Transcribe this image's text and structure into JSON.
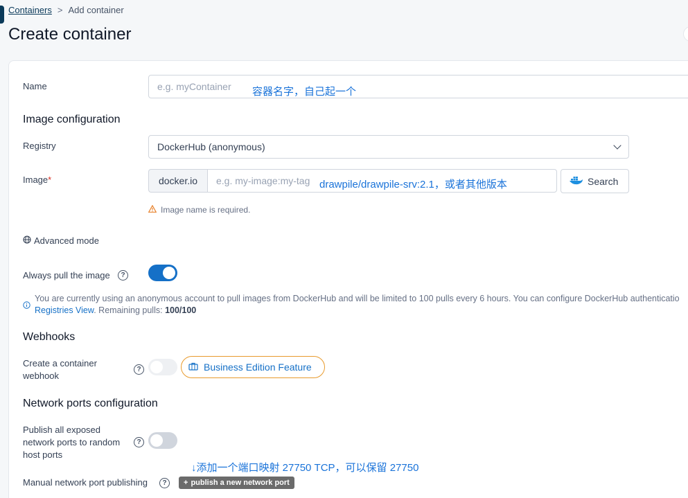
{
  "breadcrumb": {
    "parent": "Containers",
    "separator": ">",
    "current": "Add container"
  },
  "page_title": "Create container",
  "name_field": {
    "label": "Name",
    "placeholder": "e.g. myContainer",
    "annotation": "容器名字，自己起一个"
  },
  "image_config": {
    "title": "Image configuration",
    "registry_label": "Registry",
    "registry_value": "DockerHub (anonymous)",
    "image_label": "Image",
    "image_required": "*",
    "image_prefix": "docker.io",
    "image_placeholder": "e.g. my-image:my-tag",
    "image_annotation": "drawpile/drawpile-srv:2.1，或者其他版本",
    "search_label": "Search",
    "warning": "Image name is required.",
    "advanced_mode": "Advanced mode"
  },
  "always_pull": {
    "label": "Always pull the image",
    "enabled": true,
    "info_text": "You are currently using an anonymous account to pull images from DockerHub and will be limited to 100 pulls every 6 hours. You can configure DockerHub authenticatio",
    "registries_link": "Registries View",
    "remaining_label": ". Remaining pulls: ",
    "remaining_value": "100/100"
  },
  "webhooks": {
    "title": "Webhooks",
    "label": "Create a container webhook",
    "enabled": false,
    "be_feature": "Business Edition Feature"
  },
  "network": {
    "title": "Network ports configuration",
    "publish_all_label": "Publish all exposed network ports to random host ports",
    "publish_all_enabled": false,
    "annotation": "↓添加一个端口映射 27750 TCP，可以保留 27750",
    "manual_label": "Manual network port publishing",
    "publish_button": "publish a new network port"
  },
  "colors": {
    "primary": "#1570c7",
    "annotation": "#1a73d9",
    "warning": "#e89a2c"
  },
  "icons": {
    "help": "help-circle-icon",
    "warning": "alert-triangle-icon",
    "info": "info-circle-icon",
    "globe": "globe-icon",
    "docker": "docker-whale-icon",
    "briefcase": "briefcase-icon",
    "plus": "plus-icon"
  }
}
